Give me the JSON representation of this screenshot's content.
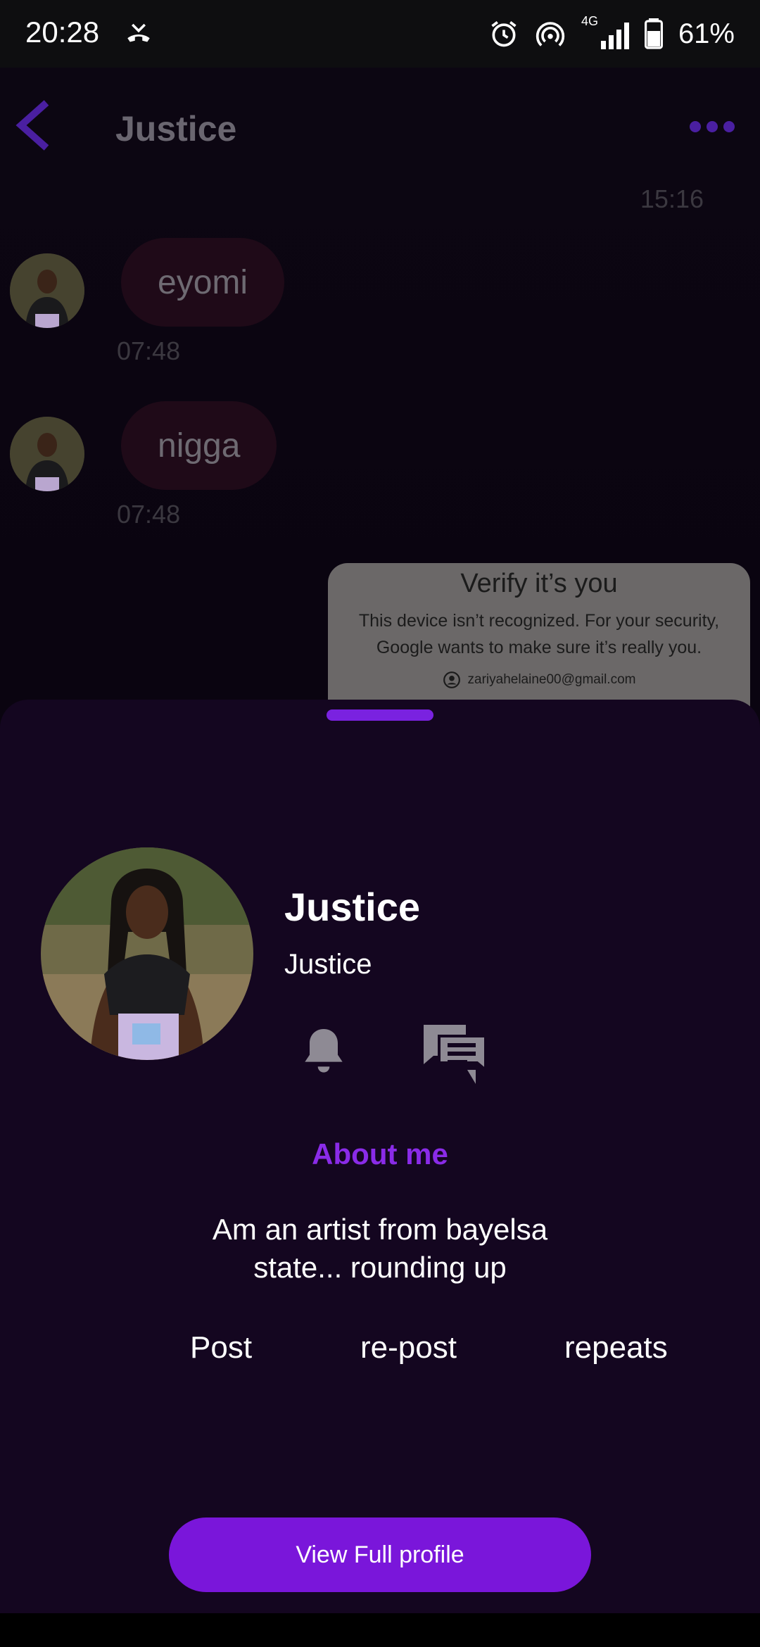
{
  "status_bar": {
    "time": "20:28",
    "network": "4G",
    "battery": "61%",
    "icons": [
      "missed-call-icon",
      "alarm-icon",
      "hotspot-icon",
      "signal-icon",
      "battery-icon"
    ]
  },
  "chat": {
    "title": "Justice",
    "top_time": "15:16",
    "messages": [
      {
        "text": "eyomi",
        "time": "07:48"
      },
      {
        "text": "nigga",
        "time": "07:48"
      }
    ],
    "attachment": {
      "title": "Verify it’s you",
      "body": "This device isn’t recognized. For your security, Google wants to make sure it’s really you.",
      "email": "zariyahelaine00@gmail.com"
    }
  },
  "profile_sheet": {
    "name": "Justice",
    "username": "Justice",
    "about_title": "About me",
    "about_text": "Am an artist from bayelsa state... rounding up",
    "tabs": [
      "Post",
      "re-post",
      "repeats"
    ],
    "view_button": "View Full profile"
  },
  "colors": {
    "accent": "#7a16da",
    "about_title": "#8a2be8",
    "sheet_bg": "#140620",
    "bubble_bg": "#1f0a18"
  }
}
